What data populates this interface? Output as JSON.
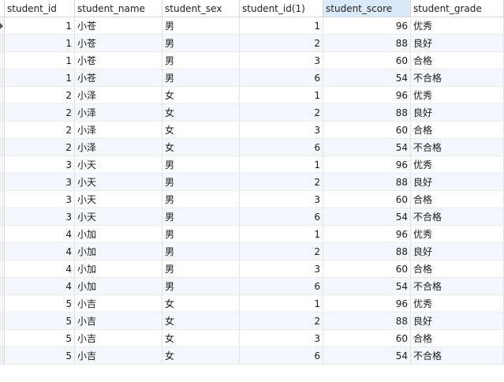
{
  "columns": [
    "student_id",
    "student_name",
    "student_sex",
    "student_id(1)",
    "student_score",
    "student_grade"
  ],
  "rows": [
    [
      "1",
      "小苍",
      "男",
      "1",
      "96",
      "优秀"
    ],
    [
      "1",
      "小苍",
      "男",
      "2",
      "88",
      "良好"
    ],
    [
      "1",
      "小苍",
      "男",
      "3",
      "60",
      "合格"
    ],
    [
      "1",
      "小苍",
      "男",
      "6",
      "54",
      "不合格"
    ],
    [
      "2",
      "小泽",
      "女",
      "1",
      "96",
      "优秀"
    ],
    [
      "2",
      "小泽",
      "女",
      "2",
      "88",
      "良好"
    ],
    [
      "2",
      "小泽",
      "女",
      "3",
      "60",
      "合格"
    ],
    [
      "2",
      "小泽",
      "女",
      "6",
      "54",
      "不合格"
    ],
    [
      "3",
      "小天",
      "男",
      "1",
      "96",
      "优秀"
    ],
    [
      "3",
      "小天",
      "男",
      "2",
      "88",
      "良好"
    ],
    [
      "3",
      "小天",
      "男",
      "3",
      "60",
      "合格"
    ],
    [
      "3",
      "小天",
      "男",
      "6",
      "54",
      "不合格"
    ],
    [
      "4",
      "小加",
      "男",
      "1",
      "96",
      "优秀"
    ],
    [
      "4",
      "小加",
      "男",
      "2",
      "88",
      "良好"
    ],
    [
      "4",
      "小加",
      "男",
      "3",
      "60",
      "合格"
    ],
    [
      "4",
      "小加",
      "男",
      "6",
      "54",
      "不合格"
    ],
    [
      "5",
      "小吉",
      "女",
      "1",
      "96",
      "优秀"
    ],
    [
      "5",
      "小吉",
      "女",
      "2",
      "88",
      "良好"
    ],
    [
      "5",
      "小吉",
      "女",
      "3",
      "60",
      "合格"
    ],
    [
      "5",
      "小吉",
      "女",
      "6",
      "54",
      "不合格"
    ]
  ],
  "selected_column": 4,
  "current_row": 0,
  "icons": {
    "row_marker": "current-row-arrow-icon"
  }
}
